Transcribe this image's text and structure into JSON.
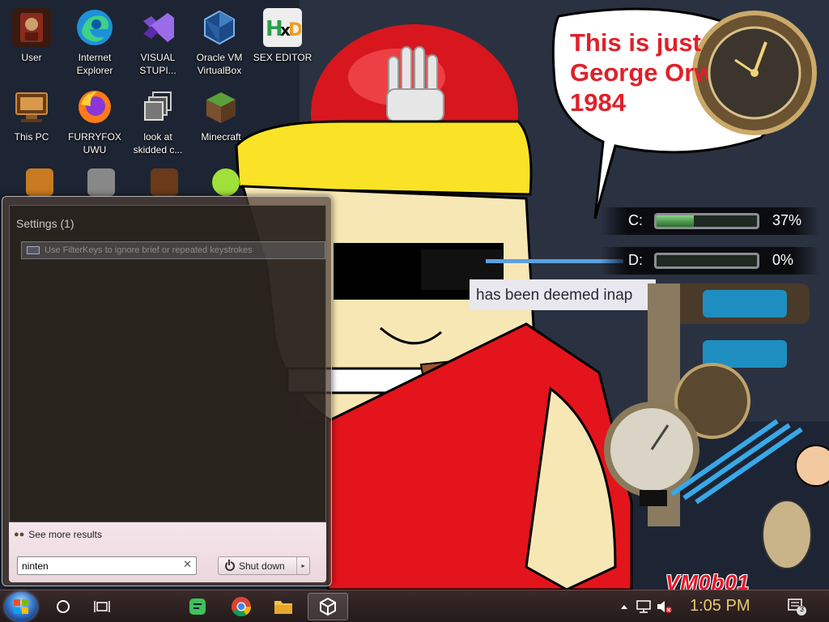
{
  "desktop": {
    "icons": [
      {
        "label": "User",
        "icon": "user-folder-icon"
      },
      {
        "label": "Internet Explorer",
        "icon": "edge-browser-icon"
      },
      {
        "label": "VISUAL STUPI...",
        "icon": "visual-studio-icon"
      },
      {
        "label": "Oracle VM VirtualBox",
        "icon": "virtualbox-icon"
      },
      {
        "label": "SEX EDITOR",
        "icon": "hex-editor-icon"
      },
      {
        "label": "This PC",
        "icon": "this-pc-icon"
      },
      {
        "label": "FURRYFOX UWU",
        "icon": "firefox-icon"
      },
      {
        "label": "look at skidded c...",
        "icon": "copy-files-icon"
      },
      {
        "label": "Minecraft",
        "icon": "minecraft-icon"
      }
    ]
  },
  "wallpaper": {
    "bubble_lines": [
      "This is just like",
      "George Orwell's",
      "1984"
    ],
    "banner_text": "has been deemed inap",
    "vm_label": "VM0b01"
  },
  "drives": [
    {
      "letter": "C:",
      "percent_text": "37%",
      "fill": 0.37
    },
    {
      "letter": "D:",
      "percent_text": "0%",
      "fill": 0.0
    }
  ],
  "start_menu": {
    "group_title": "Settings (1)",
    "result_item": "Use FilterKeys to ignore brief or repeated keystrokes",
    "see_more": "See more results",
    "search_value": "ninten",
    "shutdown_label": "Shut down",
    "shutdown_arrow": "▸",
    "clear_glyph": "✕"
  },
  "taskbar": {
    "clock": "1:05 PM",
    "notification_count": "3",
    "apps": [
      "cortana-circle-icon",
      "task-view-icon",
      "chat-app-icon",
      "chrome-icon",
      "file-explorer-icon",
      "unity-icon"
    ]
  }
}
